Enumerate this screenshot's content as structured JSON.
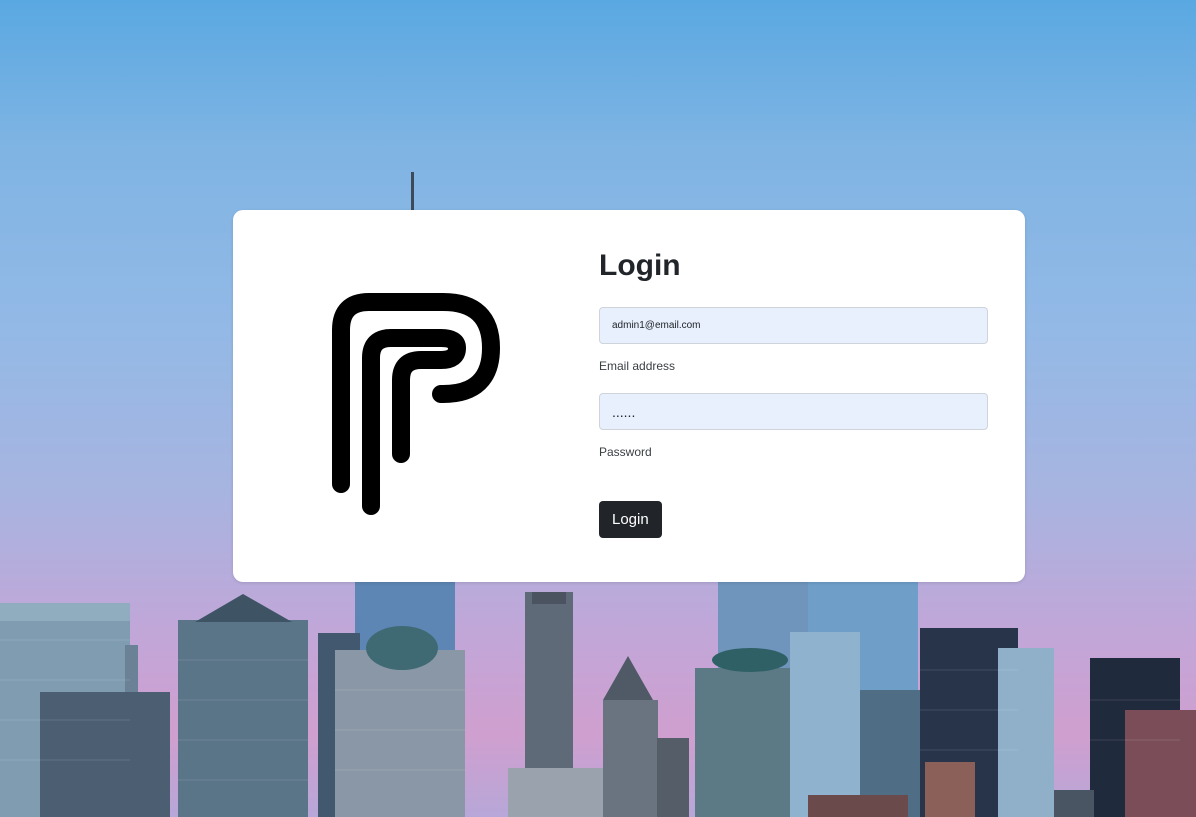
{
  "login": {
    "title": "Login",
    "email": {
      "value": "admin1@email.com",
      "label": "Email address"
    },
    "password": {
      "value": "......",
      "label": "Password"
    },
    "submit_label": "Login"
  },
  "colors": {
    "button": "#212529",
    "input_bg": "#e8f0fe",
    "card": "#ffffff"
  }
}
